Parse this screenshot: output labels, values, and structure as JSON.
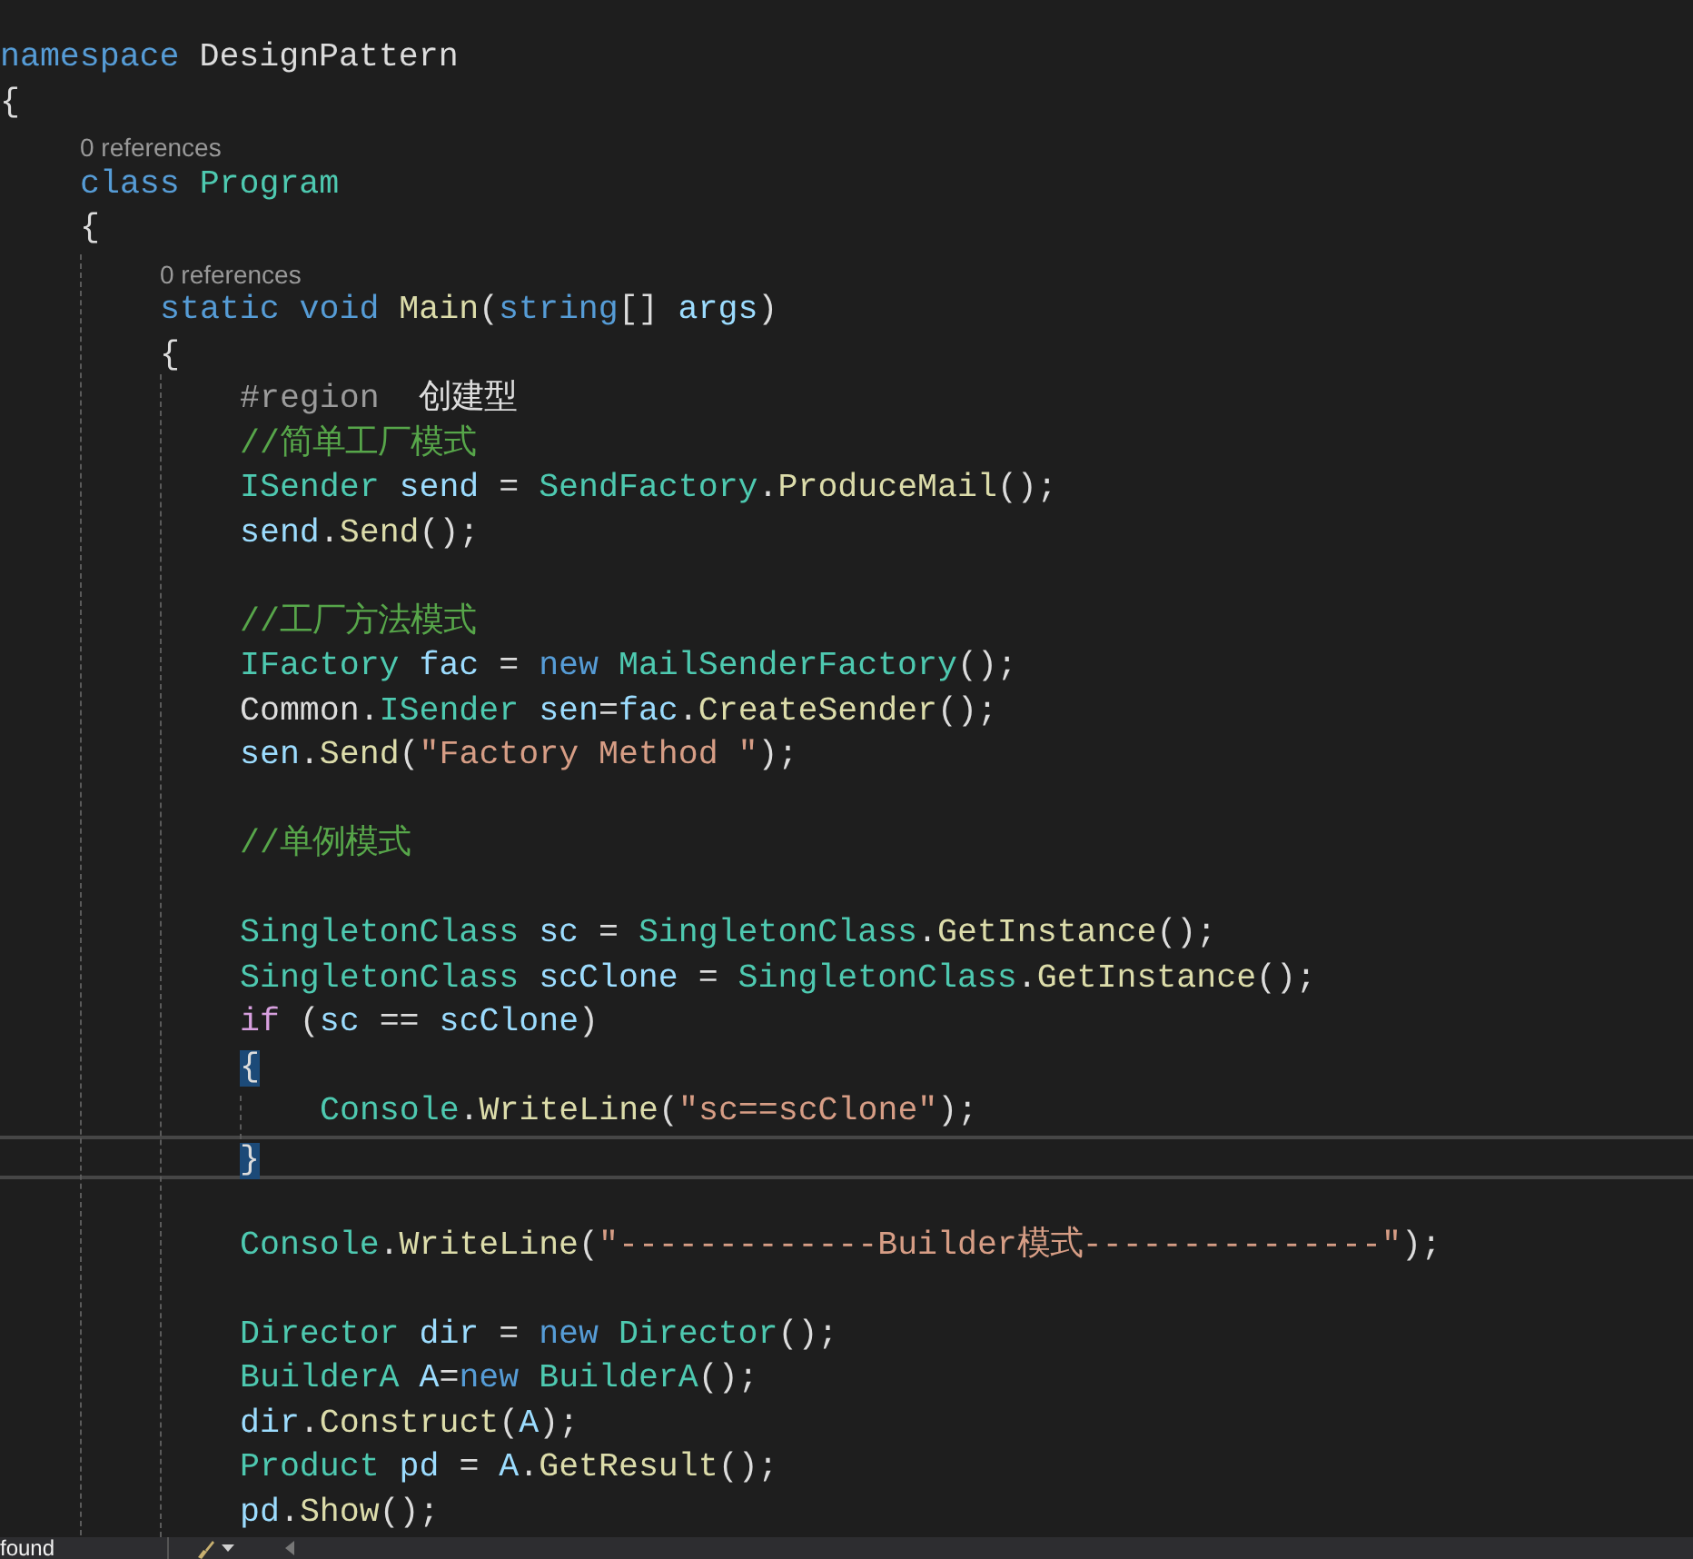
{
  "editor": {
    "lines": [
      {
        "kind": "code",
        "tokens": [
          {
            "kind": "kw",
            "text": "namespace"
          },
          {
            "kind": "plain",
            "text": " DesignPattern"
          }
        ]
      },
      {
        "kind": "code",
        "tokens": [
          {
            "kind": "pun",
            "text": "{"
          }
        ],
        "children": [
          {
            "kind": "codelens",
            "text": "0 references"
          },
          {
            "kind": "code",
            "tokens": [
              {
                "kind": "kw",
                "text": "class"
              },
              {
                "kind": "type",
                "text": " Program"
              }
            ]
          },
          {
            "kind": "code",
            "tokens": [
              {
                "kind": "pun",
                "text": "{"
              }
            ],
            "children": [
              {
                "kind": "codelens",
                "text": "0 references"
              },
              {
                "kind": "code",
                "tokens": [
                  {
                    "kind": "kw",
                    "text": "static void"
                  },
                  {
                    "kind": "fn",
                    "text": " Main"
                  },
                  {
                    "kind": "pun",
                    "text": "("
                  },
                  {
                    "kind": "kw",
                    "text": "string"
                  },
                  {
                    "kind": "pun",
                    "text": "[] "
                  },
                  {
                    "kind": "var",
                    "text": "args"
                  },
                  {
                    "kind": "pun",
                    "text": ")"
                  }
                ]
              },
              {
                "kind": "code",
                "tokens": [
                  {
                    "kind": "pun",
                    "text": "{"
                  }
                ],
                "children": [
                  {
                    "kind": "code",
                    "tokens": [
                      {
                        "kind": "pre",
                        "text": "#region"
                      },
                      {
                        "kind": "plain",
                        "text": "  创建型"
                      }
                    ]
                  },
                  {
                    "kind": "code",
                    "tokens": [
                      {
                        "kind": "cmt",
                        "text": "//简单工厂模式"
                      }
                    ]
                  },
                  {
                    "kind": "code",
                    "tokens": [
                      {
                        "kind": "type",
                        "text": "ISender"
                      },
                      {
                        "kind": "var",
                        "text": " send"
                      },
                      {
                        "kind": "pun",
                        "text": " = "
                      },
                      {
                        "kind": "type",
                        "text": "SendFactory"
                      },
                      {
                        "kind": "pun",
                        "text": "."
                      },
                      {
                        "kind": "fn",
                        "text": "ProduceMail"
                      },
                      {
                        "kind": "pun",
                        "text": "();"
                      }
                    ]
                  },
                  {
                    "kind": "code",
                    "tokens": [
                      {
                        "kind": "var",
                        "text": "send"
                      },
                      {
                        "kind": "pun",
                        "text": "."
                      },
                      {
                        "kind": "fn",
                        "text": "Send"
                      },
                      {
                        "kind": "pun",
                        "text": "();"
                      }
                    ]
                  },
                  {
                    "kind": "blank"
                  },
                  {
                    "kind": "code",
                    "tokens": [
                      {
                        "kind": "cmt",
                        "text": "//工厂方法模式"
                      }
                    ]
                  },
                  {
                    "kind": "code",
                    "tokens": [
                      {
                        "kind": "type",
                        "text": "IFactory"
                      },
                      {
                        "kind": "var",
                        "text": " fac"
                      },
                      {
                        "kind": "pun",
                        "text": " = "
                      },
                      {
                        "kind": "kw",
                        "text": "new"
                      },
                      {
                        "kind": "type",
                        "text": " MailSenderFactory"
                      },
                      {
                        "kind": "pun",
                        "text": "();"
                      }
                    ]
                  },
                  {
                    "kind": "code",
                    "tokens": [
                      {
                        "kind": "pun",
                        "text": "Common."
                      },
                      {
                        "kind": "type",
                        "text": "ISender"
                      },
                      {
                        "kind": "var",
                        "text": " sen"
                      },
                      {
                        "kind": "pun",
                        "text": "="
                      },
                      {
                        "kind": "var",
                        "text": "fac"
                      },
                      {
                        "kind": "pun",
                        "text": "."
                      },
                      {
                        "kind": "fn",
                        "text": "CreateSender"
                      },
                      {
                        "kind": "pun",
                        "text": "();"
                      }
                    ]
                  },
                  {
                    "kind": "code",
                    "tokens": [
                      {
                        "kind": "var",
                        "text": "sen"
                      },
                      {
                        "kind": "pun",
                        "text": "."
                      },
                      {
                        "kind": "fn",
                        "text": "Send"
                      },
                      {
                        "kind": "pun",
                        "text": "("
                      },
                      {
                        "kind": "str",
                        "text": "\"Factory Method \""
                      },
                      {
                        "kind": "pun",
                        "text": ");"
                      }
                    ]
                  },
                  {
                    "kind": "blank"
                  },
                  {
                    "kind": "code",
                    "tokens": [
                      {
                        "kind": "cmt",
                        "text": "//单例模式"
                      }
                    ]
                  },
                  {
                    "kind": "blank"
                  },
                  {
                    "kind": "code",
                    "tokens": [
                      {
                        "kind": "type",
                        "text": "SingletonClass"
                      },
                      {
                        "kind": "var",
                        "text": " sc"
                      },
                      {
                        "kind": "pun",
                        "text": " = "
                      },
                      {
                        "kind": "type",
                        "text": "SingletonClass"
                      },
                      {
                        "kind": "pun",
                        "text": "."
                      },
                      {
                        "kind": "fn",
                        "text": "GetInstance"
                      },
                      {
                        "kind": "pun",
                        "text": "();"
                      }
                    ]
                  },
                  {
                    "kind": "code",
                    "tokens": [
                      {
                        "kind": "type",
                        "text": "SingletonClass"
                      },
                      {
                        "kind": "var",
                        "text": " scClone"
                      },
                      {
                        "kind": "pun",
                        "text": " = "
                      },
                      {
                        "kind": "type",
                        "text": "SingletonClass"
                      },
                      {
                        "kind": "pun",
                        "text": "."
                      },
                      {
                        "kind": "fn",
                        "text": "GetInstance"
                      },
                      {
                        "kind": "pun",
                        "text": "();"
                      }
                    ]
                  },
                  {
                    "kind": "code",
                    "tokens": [
                      {
                        "kind": "ctl",
                        "text": "if"
                      },
                      {
                        "kind": "pun",
                        "text": " ("
                      },
                      {
                        "kind": "var",
                        "text": "sc"
                      },
                      {
                        "kind": "pun",
                        "text": " == "
                      },
                      {
                        "kind": "var",
                        "text": "scClone"
                      },
                      {
                        "kind": "pun",
                        "text": ")"
                      }
                    ]
                  },
                  {
                    "kind": "code",
                    "tokens": [
                      {
                        "kind": "match",
                        "text": "{"
                      }
                    ],
                    "children": [
                      {
                        "kind": "code",
                        "tokens": [
                          {
                            "kind": "type",
                            "text": "Console"
                          },
                          {
                            "kind": "pun",
                            "text": "."
                          },
                          {
                            "kind": "fn",
                            "text": "WriteLine"
                          },
                          {
                            "kind": "pun",
                            "text": "("
                          },
                          {
                            "kind": "str",
                            "text": "\"sc==scClone\""
                          },
                          {
                            "kind": "pun",
                            "text": ");"
                          }
                        ]
                      }
                    ]
                  },
                  {
                    "kind": "code",
                    "current": true,
                    "tokens": [
                      {
                        "kind": "match",
                        "text": "}"
                      }
                    ]
                  },
                  {
                    "kind": "blank"
                  },
                  {
                    "kind": "code",
                    "tokens": [
                      {
                        "kind": "type",
                        "text": "Console"
                      },
                      {
                        "kind": "pun",
                        "text": "."
                      },
                      {
                        "kind": "fn",
                        "text": "WriteLine"
                      },
                      {
                        "kind": "pun",
                        "text": "("
                      },
                      {
                        "kind": "str",
                        "text": "\"-------------Builder模式---------------\""
                      },
                      {
                        "kind": "pun",
                        "text": ");"
                      }
                    ]
                  },
                  {
                    "kind": "blank"
                  },
                  {
                    "kind": "code",
                    "tokens": [
                      {
                        "kind": "type",
                        "text": "Director"
                      },
                      {
                        "kind": "var",
                        "text": " dir"
                      },
                      {
                        "kind": "pun",
                        "text": " = "
                      },
                      {
                        "kind": "kw",
                        "text": "new"
                      },
                      {
                        "kind": "type",
                        "text": " Director"
                      },
                      {
                        "kind": "pun",
                        "text": "();"
                      }
                    ]
                  },
                  {
                    "kind": "code",
                    "tokens": [
                      {
                        "kind": "type",
                        "text": "BuilderA"
                      },
                      {
                        "kind": "var",
                        "text": " A"
                      },
                      {
                        "kind": "pun",
                        "text": "="
                      },
                      {
                        "kind": "kw",
                        "text": "new"
                      },
                      {
                        "kind": "type",
                        "text": " BuilderA"
                      },
                      {
                        "kind": "pun",
                        "text": "();"
                      }
                    ]
                  },
                  {
                    "kind": "code",
                    "tokens": [
                      {
                        "kind": "var",
                        "text": "dir"
                      },
                      {
                        "kind": "pun",
                        "text": "."
                      },
                      {
                        "kind": "fn",
                        "text": "Construct"
                      },
                      {
                        "kind": "pun",
                        "text": "("
                      },
                      {
                        "kind": "var",
                        "text": "A"
                      },
                      {
                        "kind": "pun",
                        "text": ");"
                      }
                    ]
                  },
                  {
                    "kind": "code",
                    "tokens": [
                      {
                        "kind": "type",
                        "text": "Product"
                      },
                      {
                        "kind": "var",
                        "text": " pd"
                      },
                      {
                        "kind": "pun",
                        "text": " = "
                      },
                      {
                        "kind": "var",
                        "text": "A"
                      },
                      {
                        "kind": "pun",
                        "text": "."
                      },
                      {
                        "kind": "fn",
                        "text": "GetResult"
                      },
                      {
                        "kind": "pun",
                        "text": "();"
                      }
                    ]
                  },
                  {
                    "kind": "code",
                    "tokens": [
                      {
                        "kind": "var",
                        "text": "pd"
                      },
                      {
                        "kind": "pun",
                        "text": "."
                      },
                      {
                        "kind": "fn",
                        "text": "Show"
                      },
                      {
                        "kind": "pun",
                        "text": "();"
                      }
                    ]
                  }
                ]
              }
            ]
          }
        ]
      }
    ]
  },
  "status_bar": {
    "message": "found"
  }
}
